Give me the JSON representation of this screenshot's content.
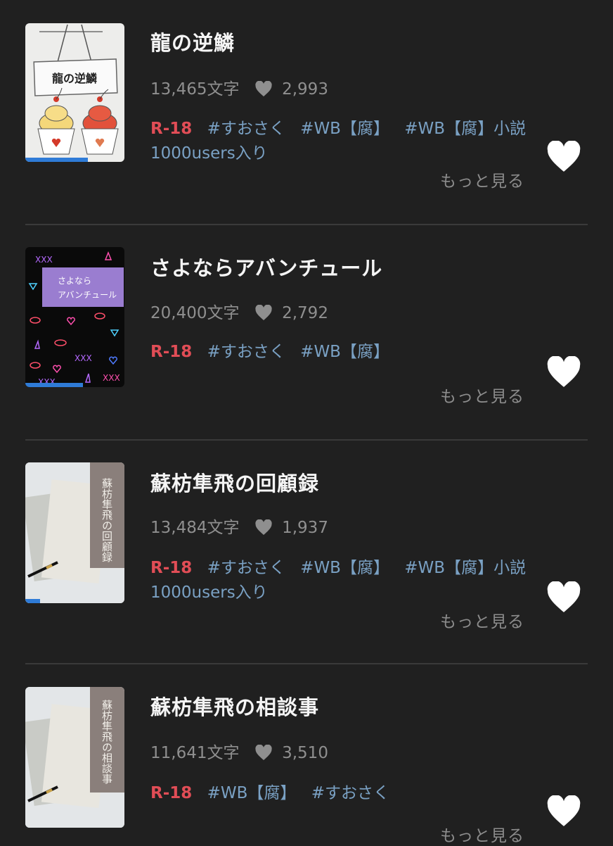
{
  "works": [
    {
      "title": "龍の逆鱗",
      "chars": "13,465文字",
      "likes": "2,993",
      "rating": "R-18",
      "tags": [
        "#すおさく",
        "#WB【腐】",
        "#WB【腐】小説1000users入り"
      ],
      "more": "もっと見る",
      "cover_text": "龍の逆鱗",
      "progress": 0.63
    },
    {
      "title": "さよならアバンチュール",
      "chars": "20,400文字",
      "likes": "2,792",
      "rating": "R-18",
      "tags": [
        "#すおさく",
        "#WB【腐】"
      ],
      "more": "もっと見る",
      "cover_text_1": "さよなら",
      "cover_text_2": "アバンチュール",
      "progress": 0.58
    },
    {
      "title": "蘇枋隼飛の回顧録",
      "chars": "13,484文字",
      "likes": "1,937",
      "rating": "R-18",
      "tags": [
        "#すおさく",
        "#WB【腐】",
        "#WB【腐】小説1000users入り"
      ],
      "more": "もっと見る",
      "cover_text": "蘇枋隼飛の回顧録",
      "progress": 0.15
    },
    {
      "title": "蘇枋隼飛の相談事",
      "chars": "11,641文字",
      "likes": "3,510",
      "rating": "R-18",
      "tags": [
        "#WB【腐】",
        "#すおさく"
      ],
      "more": "もっと見る",
      "cover_text": "蘇枋隼飛の相談事",
      "progress": 0.0
    }
  ],
  "icons": {
    "like": "heart-icon",
    "stat": "heart-icon"
  },
  "colors": {
    "background": "#202020",
    "rating": "#e14d56",
    "tag": "#7aa1c4",
    "progress": "#2f7bd7"
  }
}
